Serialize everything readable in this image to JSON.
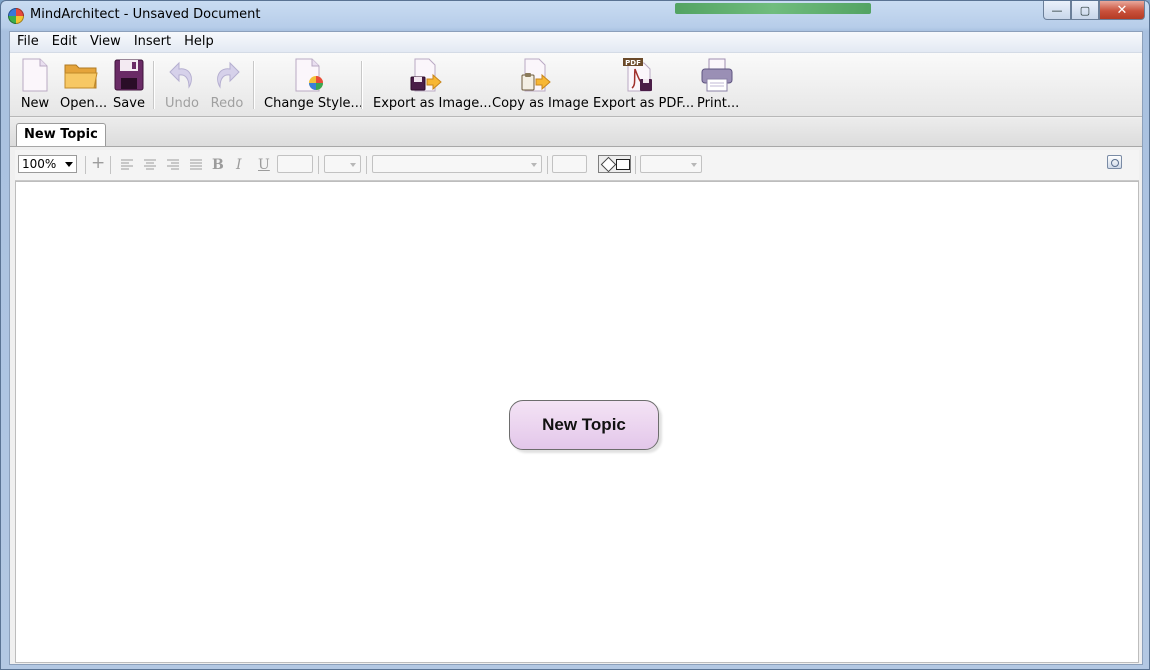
{
  "window": {
    "title": "MindArchitect - Unsaved Document",
    "controls": {
      "minimize": "—",
      "maximize": "▢",
      "close": "✕"
    }
  },
  "menu": [
    "File",
    "Edit",
    "View",
    "Insert",
    "Help"
  ],
  "toolbar": {
    "new": "New",
    "open": "Open...",
    "save": "Save",
    "undo": "Undo",
    "redo": "Redo",
    "change_style": "Change Style...",
    "export_image": "Export as Image...",
    "copy_image": "Copy as Image",
    "export_pdf": "Export as PDF...",
    "print": "Print...",
    "pdf_badge": "PDF"
  },
  "tabs": [
    {
      "label": "New Topic",
      "active": true
    }
  ],
  "format_bar": {
    "zoom": "100%",
    "add": "+",
    "bold": "B",
    "italic": "I",
    "underline": "U"
  },
  "canvas": {
    "topic": "New Topic",
    "topic_fill": "#e8d0ef",
    "topic_border": "#6d6d6d"
  }
}
